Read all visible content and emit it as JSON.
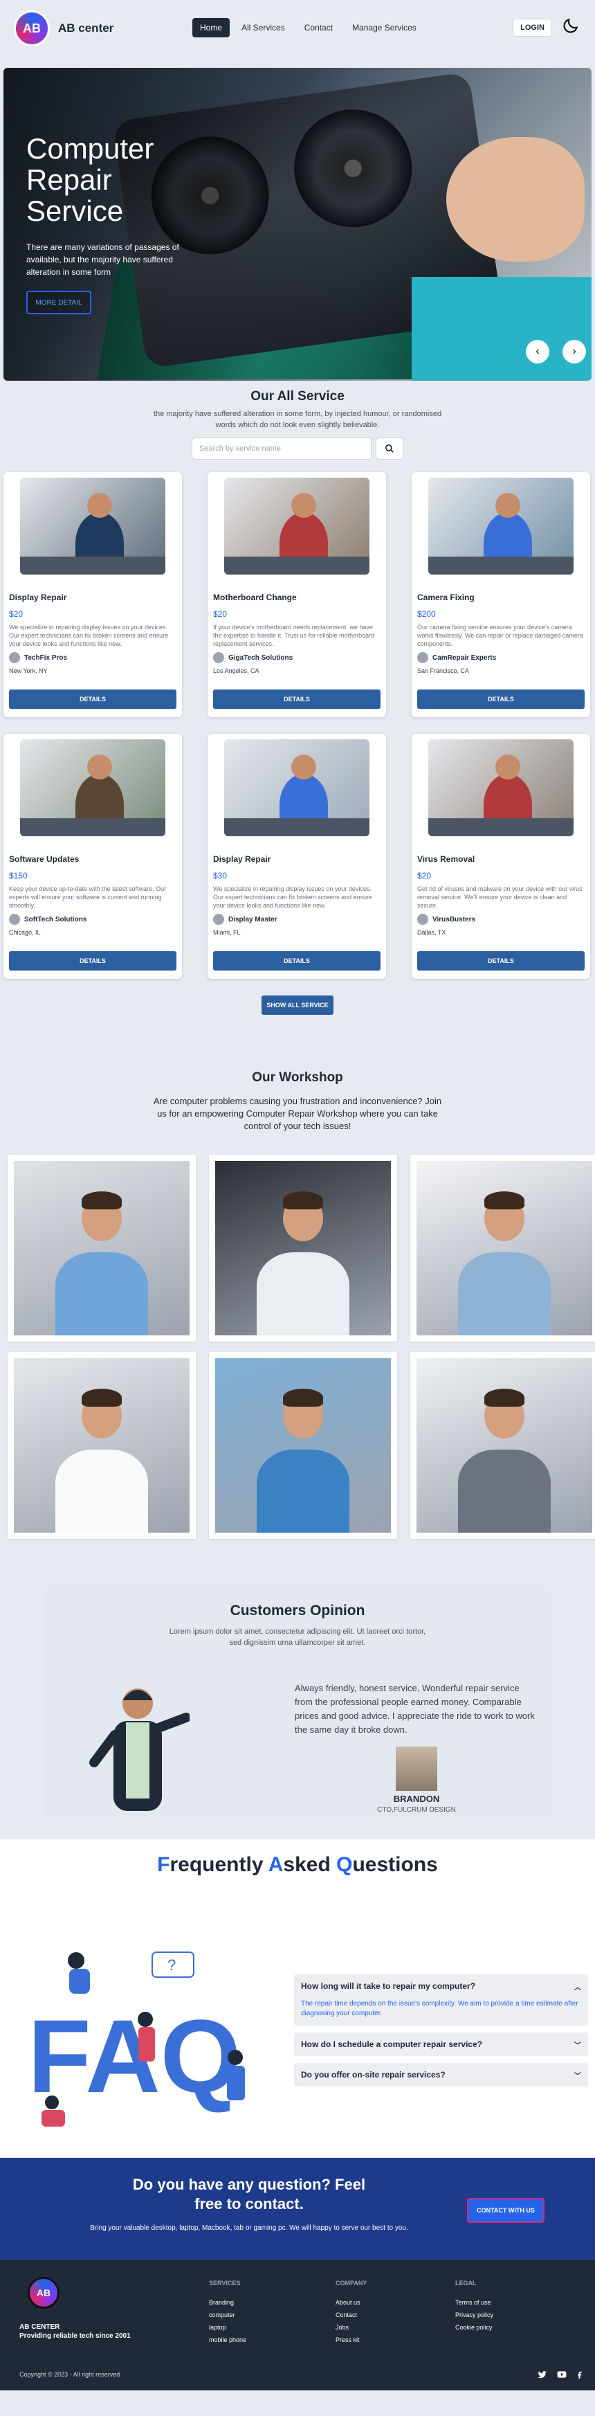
{
  "nav": {
    "brand": "AB center",
    "logo_text": "AB",
    "links": [
      "Home",
      "All Services",
      "Contact",
      "Manage Services"
    ],
    "login": "LOGIN"
  },
  "hero": {
    "title": "Computer Repair Service",
    "subtitle": "There are many variations of passages of available, but the majority have suffered alteration in some form",
    "more_label": "MORE DETAIL",
    "prev": "‹",
    "next": "›"
  },
  "services": {
    "title": "Our All Service",
    "subtitle": "the majority have suffered alteration in some form, by injected humour, or randomised words which do not look even slightly believable.",
    "search_placeholder": "Search by service name",
    "details_label": "DETAILS",
    "show_all": "SHOW ALL SERVICE",
    "cards": [
      {
        "title": "Display Repair",
        "price": "$20",
        "desc": "We specialize in repairing display issues on your devices. Our expert technicians can fix broken screens and ensure your device looks and functions like new.",
        "provider": "TechFix Pros",
        "location": "New York, NY"
      },
      {
        "title": "Motherboard Change",
        "price": "$20",
        "desc": "If your device's motherboard needs replacement, we have the expertise to handle it. Trust us for reliable motherboard replacement services.",
        "provider": "GigaTech Solutions",
        "location": "Los Angeles, CA"
      },
      {
        "title": "Camera Fixing",
        "price": "$200",
        "desc": "Our camera fixing service ensures your device's camera works flawlessly. We can repair or replace damaged camera components.",
        "provider": "CamRepair Experts",
        "location": "San Francisco, CA"
      },
      {
        "title": "Software Updates",
        "price": "$150",
        "desc": "Keep your device up-to-date with the latest software. Our experts will ensure your software is current and running smoothly.",
        "provider": "SoftTech Solutions",
        "location": "Chicago, IL"
      },
      {
        "title": "Display Repair",
        "price": "$30",
        "desc": "We specialize in repairing display issues on your devices. Our expert technicians can fix broken screens and ensure your device looks and functions like new.",
        "provider": "Display Master",
        "location": "Miami, FL"
      },
      {
        "title": "Virus Removal",
        "price": "$20",
        "desc": "Get rid of viruses and malware on your device with our virus removal service. We'll ensure your device is clean and secure.",
        "provider": "VirusBusters",
        "location": "Dallas, TX"
      }
    ]
  },
  "workshop": {
    "title": "Our Workshop",
    "subtitle": "Are computer problems causing you frustration and inconvenience? Join us for an empowering Computer Repair Workshop where you can take control of your tech issues!"
  },
  "opinion": {
    "title": "Customers Opinion",
    "subtitle": "Lorem ipsum dolor sit amet, consectetur adipiscing elit. Ut laoreet orci tortor, sed dignissim urna ullamcorper sit amet.",
    "quote": "Always friendly, honest service. Wonderful repair service from the professional people earned money. Comparable prices and good advice. I appreciate the ride to work to work the same day it broke down.",
    "name": "BRANDON",
    "role": "CTO,FULCRUM DESIGN"
  },
  "faq": {
    "title_parts": [
      "F",
      "requently ",
      "A",
      "sked ",
      "Q",
      "uestions"
    ],
    "art_text": "FAQ",
    "items": [
      {
        "q": "How long will it take to repair my computer?",
        "a": "The repair time depends on the issue's complexity. We aim to provide a time estimate after diagnosing your computer.",
        "open": true
      },
      {
        "q": "How do I schedule a computer repair service?",
        "open": false
      },
      {
        "q": "Do you offer on-site repair services?",
        "open": false
      }
    ]
  },
  "contact": {
    "title": "Do you have any question? Feel free to contact.",
    "text": "Bring your valuable desktop, laptop, Macbook, tab or gaming pc. We will happy to serve our best to you.",
    "button": "CONTACT WITH US"
  },
  "footer": {
    "logo_text": "AB",
    "brand": "AB CENTER",
    "tagline": "Providing reliable tech since 2001",
    "cols": [
      {
        "heading": "SERVICES",
        "links": [
          "Branding",
          "computer",
          "laptop",
          "mobile phone"
        ]
      },
      {
        "heading": "COMPANY",
        "links": [
          "About us",
          "Contact",
          "Jobs",
          "Press kit"
        ]
      },
      {
        "heading": "LEGAL",
        "links": [
          "Terms of use",
          "Privacy policy",
          "Cookie policy"
        ]
      }
    ],
    "copyright": "Copyright © 2023 - All right reserved",
    "social_icons": [
      "twitter-icon",
      "youtube-icon",
      "facebook-icon"
    ]
  },
  "colors": {
    "accent": "#2563eb",
    "button": "#2c5fa0",
    "contact_bg": "#1e3a8a",
    "footer_bg": "#1f2937"
  }
}
